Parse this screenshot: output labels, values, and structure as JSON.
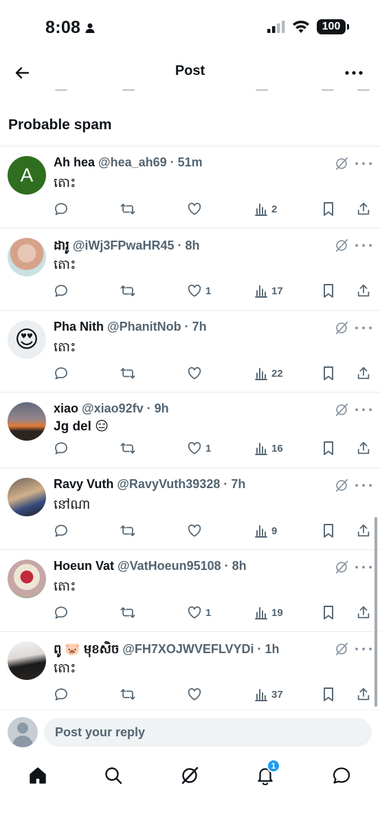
{
  "status_bar": {
    "time": "8:08",
    "battery": "100"
  },
  "header": {
    "title": "Post"
  },
  "section": {
    "title": "Probable spam"
  },
  "replies": [
    {
      "name": "Ah hea",
      "handle": "@hea_ah69",
      "time": "51m",
      "text": "តោះ",
      "avatar_letter": "A",
      "likes": "",
      "views": "2"
    },
    {
      "name": "ដារូ",
      "handle": "@iWj3FPwaHR45",
      "time": "8h",
      "text": "តោះ",
      "likes": "1",
      "views": "17"
    },
    {
      "name": "Pha Nith",
      "handle": "@PhanitNob",
      "time": "7h",
      "text": "តោះ",
      "avatar_emoji": "😍",
      "likes": "",
      "views": "22"
    },
    {
      "name": "xiao",
      "handle": "@xiao92fv",
      "time": "9h",
      "text": "Jg del 😑",
      "likes": "1",
      "views": "16"
    },
    {
      "name": "Ravy Vuth",
      "handle": "@RavyVuth39328",
      "time": "7h",
      "text": "នៅណា",
      "likes": "",
      "views": "9"
    },
    {
      "name": "Hoeun Vat",
      "handle": "@VatHoeun95108",
      "time": "8h",
      "text": "តោះ",
      "likes": "1",
      "views": "19"
    },
    {
      "name": "ពូ 🐷 មុខសិច",
      "handle": "@FH7XOJWVEFLVYDi",
      "time": "1h",
      "text": "តោះ",
      "likes": "",
      "views": "37"
    }
  ],
  "reply_bar": {
    "placeholder": "Post your reply"
  },
  "bottom_nav": {
    "notification_count": "1"
  }
}
